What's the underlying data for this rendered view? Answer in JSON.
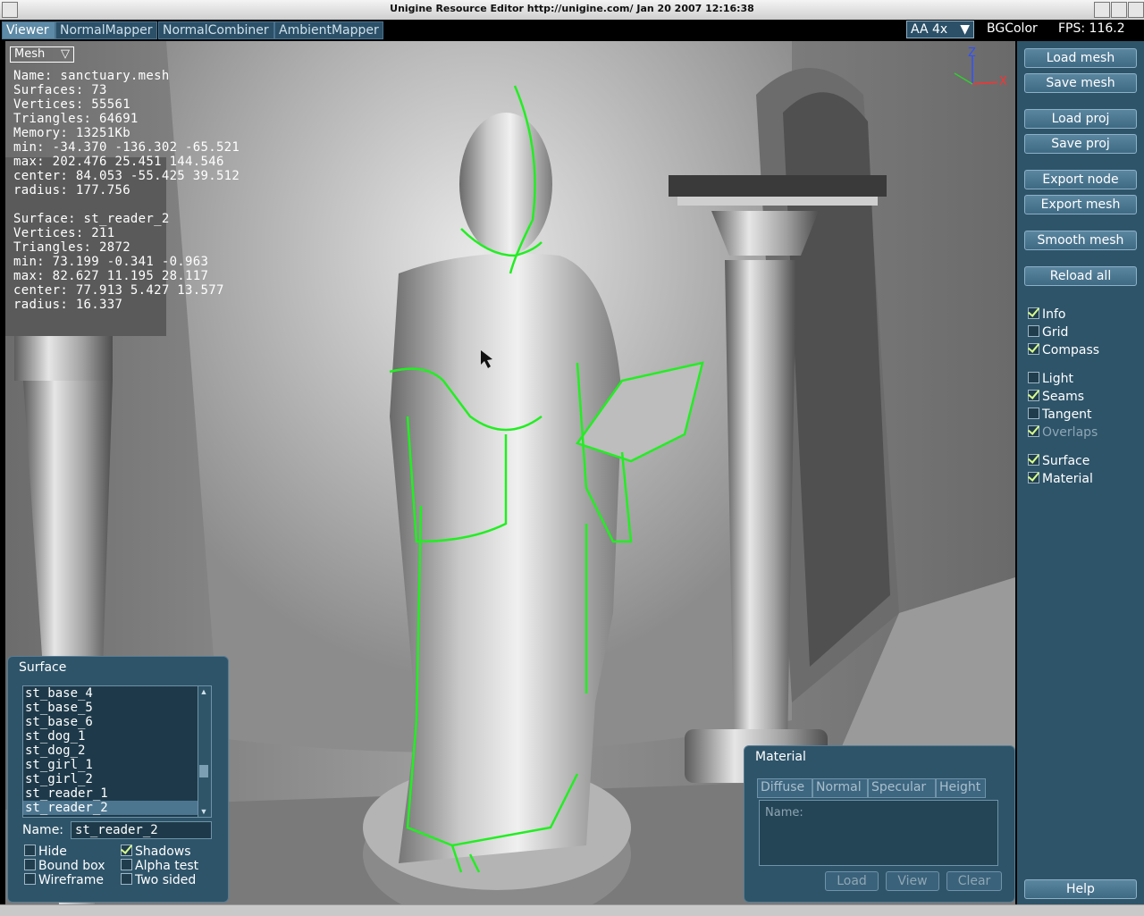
{
  "window": {
    "title": "Unigine Resource Editor http://unigine.com/ Jan 20 2007 12:16:38"
  },
  "tabs": [
    {
      "label": "Viewer"
    },
    {
      "label": "NormalMapper"
    },
    {
      "label": "NormalCombiner"
    },
    {
      "label": "AmbientMapper"
    }
  ],
  "toolbar": {
    "aa_value": "AA 4x",
    "aa_arrow": "▼",
    "bgcolor_label": "BGColor",
    "fps_label": "FPS: 116.2"
  },
  "viewport": {
    "mode_select": "Mesh",
    "mode_arrow": "▽",
    "mesh_info": [
      "Name: sanctuary.mesh",
      "Surfaces: 73",
      "Vertices: 55561",
      "Triangles: 64691",
      "Memory: 13251Kb",
      "min: -34.370 -136.302 -65.521",
      "max: 202.476 25.451 144.546",
      "center: 84.053 -55.425 39.512",
      "radius: 177.756"
    ],
    "surface_info": [
      "Surface: st_reader_2",
      "Vertices: 211",
      "Triangles: 2872",
      "min: 73.199 -0.341 -0.963",
      "max: 82.627 11.195 28.117",
      "center: 77.913 5.427 13.577",
      "radius: 16.337"
    ],
    "compass": {
      "z": "Z",
      "x": "X"
    }
  },
  "right_panel": {
    "buttons": [
      "Load mesh",
      "Save mesh",
      "Load proj",
      "Save proj",
      "Export node",
      "Export mesh",
      "Smooth mesh",
      "Reload all"
    ],
    "checkboxes": [
      {
        "label": "Info",
        "checked": true,
        "enabled": true
      },
      {
        "label": "Grid",
        "checked": false,
        "enabled": true
      },
      {
        "label": "Compass",
        "checked": true,
        "enabled": true
      },
      {
        "label": "Light",
        "checked": false,
        "enabled": true
      },
      {
        "label": "Seams",
        "checked": true,
        "enabled": true
      },
      {
        "label": "Tangent",
        "checked": false,
        "enabled": true
      },
      {
        "label": "Overlaps",
        "checked": true,
        "enabled": false
      },
      {
        "label": "Surface",
        "checked": true,
        "enabled": true
      },
      {
        "label": "Material",
        "checked": true,
        "enabled": true
      }
    ],
    "help_label": "Help"
  },
  "surface_panel": {
    "title": "Surface",
    "items": [
      "st_base_4",
      "st_base_5",
      "st_base_6",
      "st_dog_1",
      "st_dog_2",
      "st_girl_1",
      "st_girl_2",
      "st_reader_1",
      "st_reader_2"
    ],
    "selected": "st_reader_2",
    "name_label": "Name:",
    "name_value": "st_reader_2",
    "options": [
      {
        "label": "Hide",
        "checked": false
      },
      {
        "label": "Shadows",
        "checked": true
      },
      {
        "label": "Bound box",
        "checked": false
      },
      {
        "label": "Alpha test",
        "checked": false
      },
      {
        "label": "Wireframe",
        "checked": false
      },
      {
        "label": "Two sided",
        "checked": false
      }
    ]
  },
  "material_panel": {
    "title": "Material",
    "tabs": [
      "Diffuse",
      "Normal",
      "Specular",
      "Height"
    ],
    "name_placeholder": "Name:",
    "buttons": [
      "Load",
      "View",
      "Clear"
    ]
  },
  "colors": {
    "panel": "#2e5469",
    "seam": "#22ee22",
    "accent": "#5d8aa6"
  }
}
